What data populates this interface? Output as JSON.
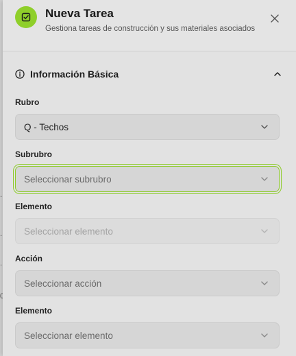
{
  "backdrop": {
    "chars": [
      ".",
      ".",
      ".",
      "0",
      "0"
    ]
  },
  "header": {
    "title": "Nueva Tarea",
    "subtitle": "Gestiona tareas de construcción y sus materiales asociados",
    "icon": "checkbox-icon",
    "accent_color": "#8fcf2a"
  },
  "section": {
    "title": "Información Básica",
    "icon": "info-icon",
    "state": "expanded"
  },
  "fields": [
    {
      "label": "Rubro",
      "value": "Q - Techos",
      "placeholder": "",
      "state": "filled"
    },
    {
      "label": "Subrubro",
      "value": "",
      "placeholder": "Seleccionar subrubro",
      "state": "focused"
    },
    {
      "label": "Elemento",
      "value": "",
      "placeholder": "Seleccionar elemento",
      "state": "disabled"
    },
    {
      "label": "Acción",
      "value": "",
      "placeholder": "Seleccionar acción",
      "state": "enabled"
    },
    {
      "label": "Elemento",
      "value": "",
      "placeholder": "Seleccionar elemento",
      "state": "enabled"
    }
  ]
}
